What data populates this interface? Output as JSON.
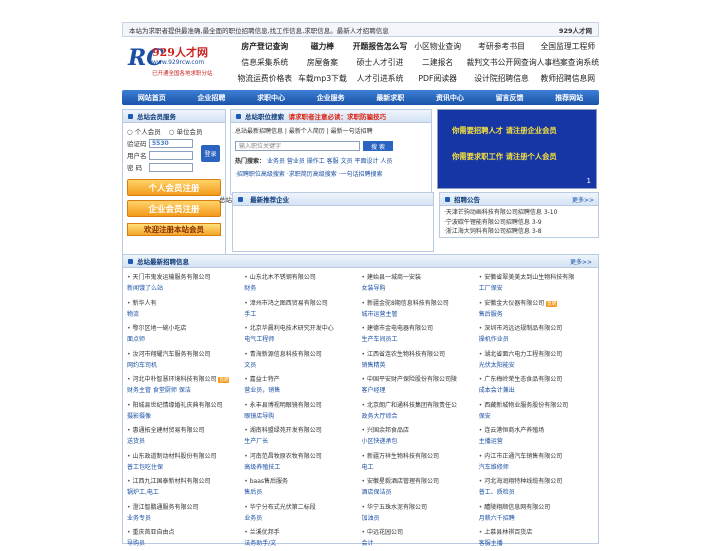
{
  "topbar": {
    "text": "本站为求职者提供最准确,最全面的职位招聘信息,找工作信息,求职信息。最新人才招聘信息",
    "site": "929人才网"
  },
  "logo": {
    "rc": "RC",
    "cn": "929人才网",
    "url": "www.929rcw.com",
    "slogan": "已开通全国各地求职分站"
  },
  "quick": [
    "房产登记查询",
    "磁力棒",
    "开题报告怎么写",
    "小区物业查询",
    "考研参考书目",
    "全国监理工程师",
    "信息采集系统",
    "房屋备案",
    "硕士人才引进",
    "二建报名",
    "裁判文书公开网查询",
    "人事档案查询系统",
    "物流运费价格表",
    "车载mp3下载",
    "人才引进系统",
    "PDF阅读器",
    "设计院招聘信息",
    "教师招聘信息网"
  ],
  "quick_bold": [
    0,
    1,
    2
  ],
  "nav": [
    "网站首页",
    "企业招聘",
    "求职中心",
    "企业服务",
    "最新求职",
    "资讯中心",
    "留言反馈",
    "推荐网站"
  ],
  "login": {
    "title": "总站会员服务",
    "r1": "个人会员",
    "r2": "单位会员",
    "l_code": "验证码",
    "code": "5530",
    "l_user": "用户名",
    "l_pwd": "密  码",
    "btn": "登录",
    "reg_person": "个人会员注册",
    "reg_company": "企业会员注册",
    "welcome": "欢迎注册本站会员"
  },
  "mid": {
    "title": "总站职位搜索",
    "warn": "请求职者注意必读：求职防骗技巧",
    "sub": "总站最新招聘信息 | 最新个人简历 | 最新一句话招聘",
    "placeholder": "输入职位关键字",
    "btn": "搜 索",
    "hot_label": "热门搜索：",
    "hot": "业务员 营业员 操作工 客服 文员 平面设计 人员",
    "links": "·招聘职位高级搜索  ·求职简历高级搜索  ·一句话招聘搜索"
  },
  "ad": {
    "l1": "你需要招聘人才 请注册企业会员",
    "l2": "你需要求职工作 请注册个人会员",
    "num": "1"
  },
  "rec": {
    "label": "总站",
    "title": "最新推荐企业"
  },
  "ann": {
    "title": "招聘公告",
    "more": "更多>>",
    "items": [
      "·天津芒驹动画科技有限公司招聘信息 3-10",
      "·宁波碳午锂能有限公司招聘信息 3-9",
      "·浙江海大饲料有限公司招聘信息 3-8"
    ]
  },
  "jobs": {
    "title": "总站最新招聘信息",
    "more": "更多>>",
    "items": [
      {
        "co": "天门市鬼发运输服务有限公司",
        "pos": "新闻饿了么站"
      },
      {
        "co": "山东北木不锈钢有限公司",
        "pos": "财务"
      },
      {
        "co": "建始县一城商一安装",
        "pos": "女装导购"
      },
      {
        "co": "安徽省翠美美太到山生物科技有限",
        "pos": "工厂保安"
      },
      {
        "co": "新华人有",
        "pos": "物流"
      },
      {
        "co": "漳州市鸿之图西贸易有限公司",
        "pos": "手工"
      },
      {
        "co": "新疆金驼8期信息科技有限公司",
        "pos": "城市运营主管"
      },
      {
        "co": "安徽金大仪器有限公司",
        "pos": "售后服务",
        "tag": "急聘"
      },
      {
        "co": "鄂尔区地一碗小吃店",
        "pos": "面点师"
      },
      {
        "co": "北京华晨利电技术研究开发中心",
        "pos": "电气工程师"
      },
      {
        "co": "建德市金电电器有限公司",
        "pos": "生产车间员工"
      },
      {
        "co": "深圳市鸿远达规制品有限公司",
        "pos": "操机作业员"
      },
      {
        "co": "汝河市翔耀汽车服务有限公司",
        "pos": "网约车司机"
      },
      {
        "co": "青海新源信息科技有限公司",
        "pos": "文员"
      },
      {
        "co": "江西省连农生物科技有限公司",
        "pos": "销售精英"
      },
      {
        "co": "湖北省面六电力工程有限公司",
        "pos": "光伏太阳能安"
      },
      {
        "co": "河北中朴智慧环境科技有限公司",
        "pos": "财务主管 食堂厨师 保洁",
        "tag": "急聘"
      },
      {
        "co": "嘉益士特产",
        "pos": "营业员，销售"
      },
      {
        "co": "中国平安财产保险股份有限公司陵",
        "pos": "客户经理"
      },
      {
        "co": "广东梅岭荣生态食品有限公司",
        "pos": "成本会计兼出"
      },
      {
        "co": "阳城县世纪情缘婚礼庆典有限公司",
        "pos": "摄影摄像"
      },
      {
        "co": "永丰县博视明眼镜有限公司",
        "pos": "眼镜店导购"
      },
      {
        "co": "北京朗广和通科技集团有限责任公",
        "pos": "政务大厅综合"
      },
      {
        "co": "西藏新城物业服务股份有限公司",
        "pos": "保安"
      },
      {
        "co": "惠通拓全建材贸易有限公司",
        "pos": "送货员"
      },
      {
        "co": "湖南科盟绿苑开发有限公司",
        "pos": "生产厂长"
      },
      {
        "co": "兴国余邦食品店",
        "pos": "小区快递承包"
      },
      {
        "co": "连云港恒商水产养殖场",
        "pos": "主播运营"
      },
      {
        "co": "山东政道制动材料股份有限公司",
        "pos": "普工包吃住保"
      },
      {
        "co": "河南范昌牧原农牧有限公司",
        "pos": "高级养殖技工"
      },
      {
        "co": "新疆万祥生物科技有限公司",
        "pos": "电工"
      },
      {
        "co": "内江市正通汽车销售有限公司",
        "pos": "汽车维修师"
      },
      {
        "co": "江西九江国泰新材料有限公司",
        "pos": "锅炉工,电工"
      },
      {
        "co": "baas售后服务",
        "pos": "售后员"
      },
      {
        "co": "安徽星毅酒店管理有限公司",
        "pos": "酒店保洁员"
      },
      {
        "co": "河北海润翔特种线缆有限公司",
        "pos": "普工、质检员"
      },
      {
        "co": "澄江智鹏通服务有限公司",
        "pos": "业务专员"
      },
      {
        "co": "华宁分布式光伏第二标段",
        "pos": "业务员"
      },
      {
        "co": "华宁五珠水泥有限公司",
        "pos": "加油员"
      },
      {
        "co": "醴陵翔顺信息网有限公司",
        "pos": "月薪六千招聘"
      },
      {
        "co": "重庆首亚自由点",
        "pos": "导购员"
      },
      {
        "co": "兰溪优邦手",
        "pos": "法务助手/文"
      },
      {
        "co": "中远花园公司",
        "pos": "会计"
      },
      {
        "co": "上慕县林祺百货店",
        "pos": "客服主播"
      }
    ]
  },
  "colors": {
    "nav": "#1953a8",
    "accent": "#f39a1f",
    "link": "#1a4fa3"
  }
}
